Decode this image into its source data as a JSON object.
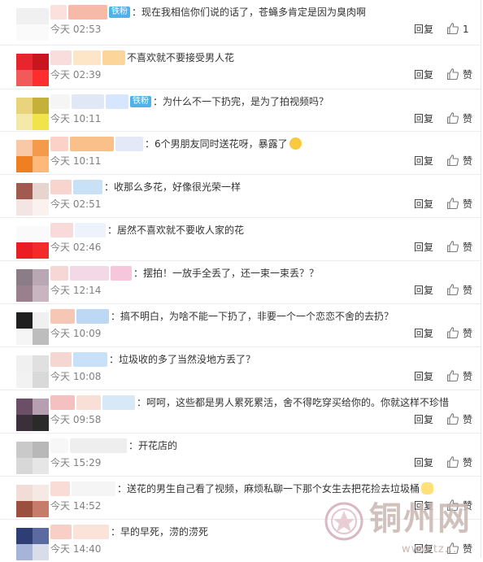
{
  "comments": [
    {
      "badge": "铁粉",
      "text": "：现在我相信你们说的话了，苍蝇多肯定是因为臭肉啊",
      "time": "今天 02:53",
      "reply": "回复",
      "like": "1",
      "avatar": [
        "#f0f0f0",
        "#f0f0f0",
        "#fafafa",
        "#fafafa"
      ],
      "name_colors": [
        "#fbe0de",
        "#f7b9a8"
      ],
      "emoji": ""
    },
    {
      "badge": "",
      "text": "不喜欢就不要接受男人花",
      "time": "今天 02:39",
      "reply": "回复",
      "like": "赞",
      "avatar": [
        "#e8242c",
        "#c9151d",
        "#f25a5a",
        "#ff2e2e"
      ],
      "name_colors": [
        "#f9dcdc",
        "#fde6c7",
        "#fcd59b"
      ],
      "emoji": ""
    },
    {
      "badge": "铁粉",
      "text": "：为什么不一下扔完，是为了拍视频吗？",
      "time": "今天 10:11",
      "reply": "回复",
      "like": "赞",
      "avatar": [
        "#e9d37d",
        "#c5b03a",
        "#f4e9a8",
        "#f1e44b"
      ],
      "name_colors": [
        "#f5f5f5",
        "#e0e8f5",
        "#d6e6ff"
      ],
      "emoji": ""
    },
    {
      "badge": "",
      "text": "：6个男朋友同时送花呀，暴露了",
      "time": "今天 10:11",
      "reply": "回复",
      "like": "赞",
      "avatar": [
        "#f9c9a5",
        "#f39a4b",
        "#f07f22",
        "#ffb77a"
      ],
      "name_colors": [
        "#fbd1c8",
        "#f9c08a",
        "#e4e9f7"
      ],
      "emoji": "face"
    },
    {
      "badge": "",
      "text": "：收那么多花，好像很光荣一样",
      "time": "今天 02:51",
      "reply": "回复",
      "like": "赞",
      "avatar": [
        "#a15a4f",
        "#e8d4cf",
        "#f3e6e2",
        "#fbf2ef"
      ],
      "name_colors": [
        "#f8d4cf",
        "#c9e1f7"
      ],
      "emoji": ""
    },
    {
      "badge": "",
      "text": "：居然不喜欢就不要收人家的花",
      "time": "今天 02:46",
      "reply": "回复",
      "like": "赞",
      "avatar": [
        "#fafafa",
        "#fafafa",
        "#ec1c24",
        "#f22a2a"
      ],
      "name_colors": [
        "#f8dada",
        "#eef3fb"
      ],
      "emoji": ""
    },
    {
      "badge": "",
      "text": "：摆拍！一放手全丢了，还一束一束丢？？",
      "time": "今天 12:14",
      "reply": "回复",
      "like": "赞",
      "avatar": [
        "#8a7d86",
        "#b9a7b3",
        "#9a7f8c",
        "#c9b5bf"
      ],
      "name_colors": [
        "#f7d6d6",
        "#f3d8e8",
        "#f6c6dc"
      ],
      "emoji": ""
    },
    {
      "badge": "",
      "text": "：搞不明白，为啥不能一下扔了，非要一个一个恋恋不舍的去扔？",
      "time": "今天 10:09",
      "reply": "回复",
      "like": "赞",
      "avatar": [
        "#1f1f1f",
        "#f0f0f0",
        "#f5f5f5",
        "#bdbdbd"
      ],
      "name_colors": [
        "#f5c7b4",
        "#bcd8f5"
      ],
      "emoji": ""
    },
    {
      "badge": "",
      "text": "：垃圾收的多了当然没地方丢了？",
      "time": "今天 10:08",
      "reply": "回复",
      "like": "赞",
      "avatar": [
        "#f0f0f0",
        "#e0e0e0",
        "#f2f2f2",
        "#d9d9d9"
      ],
      "name_colors": [
        "#f5d6d0",
        "#c8e0f8"
      ],
      "emoji": ""
    },
    {
      "badge": "",
      "text": "：呵呵，这些都是男人累死累活，舍不得吃穿买给你的。你就这样不珍惜",
      "time": "今天 09:58",
      "reply": "回复",
      "like": "赞",
      "avatar": [
        "#6a4f66",
        "#b79fb2",
        "#3a2f3a",
        "#2a2a2a"
      ],
      "name_colors": [
        "#f5c0c0",
        "#f8e0d6",
        "#d7e9f7"
      ],
      "emoji": ""
    },
    {
      "badge": "",
      "text": "：开花店的",
      "time": "今天 15:29",
      "reply": "回复",
      "like": "赞",
      "avatar": [
        "#c9c9c9",
        "#b8b8b8",
        "#d8d8d8",
        "#e6e6e6"
      ],
      "name_colors": [
        "#f7f7f7",
        "#eeeeee"
      ],
      "emoji": ""
    },
    {
      "badge": "",
      "text": "：送花的男生自己看了视频，麻烦私聊一下那个女生去把花捡去垃圾桶",
      "time": "今天 14:52",
      "reply": "回复",
      "like": "赞",
      "avatar": [
        "#f2ddd6",
        "#f6e8e3",
        "#9a4f3f",
        "#c57c6a"
      ],
      "name_colors": [
        "#f9dcd6",
        "#f5f5f5"
      ],
      "emoji": "cat"
    },
    {
      "badge": "",
      "text": "：早的早死，涝的涝死",
      "time": "今天 14:40",
      "reply": "回复",
      "like": "赞",
      "avatar": [
        "#2c3e74",
        "#5b6aa0",
        "#a7b4d9",
        "#d7dde9"
      ],
      "name_colors": [
        "#f7cfc7",
        "#fbe3da"
      ],
      "emoji": ""
    }
  ],
  "watermark": {
    "text": "铜州网",
    "url": "www.tz..."
  },
  "colors": {
    "username": "#eb7350",
    "badge": "#4fb3e6",
    "time": "#808080",
    "divider": "#ececec"
  },
  "icons": {
    "like": "thumbs-up-icon"
  }
}
